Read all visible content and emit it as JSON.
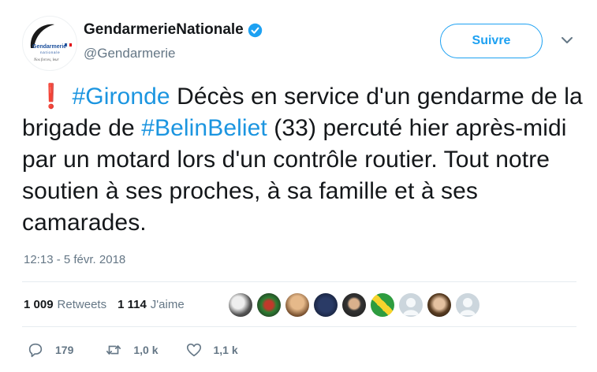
{
  "account": {
    "display_name": "GendarmerieNationale",
    "handle": "@Gendarmerie",
    "avatar_text": "Gendarmerie",
    "avatar_subtext": "nationale",
    "avatar_motto": "Nos forces, leur"
  },
  "follow_label": "Suivre",
  "tweet": {
    "emoji": "❗",
    "hashtag_1": "#Gironde",
    "text_1": " Décès en service d'un gendarme de la brigade de ",
    "hashtag_2": "#BelinBeliet",
    "text_2": " (33) percuté hier après-midi par un motard lors d'un contrôle routier. Tout notre soutien à ses proches, à sa famille et à ses camarades."
  },
  "timestamp": "12:13 - 5 févr. 2018",
  "stats": {
    "retweets_count": "1 009",
    "retweets_label": "Retweets",
    "likes_count": "1 114",
    "likes_label": "J'aime"
  },
  "actions": {
    "reply_count": "179",
    "retweet_count": "1,0 k",
    "like_count": "1,1 k"
  },
  "colors": {
    "accent": "#1da1f2",
    "hashtag": "#1b95e0",
    "secondary_text": "#657786",
    "divider": "#e6ecf0"
  }
}
